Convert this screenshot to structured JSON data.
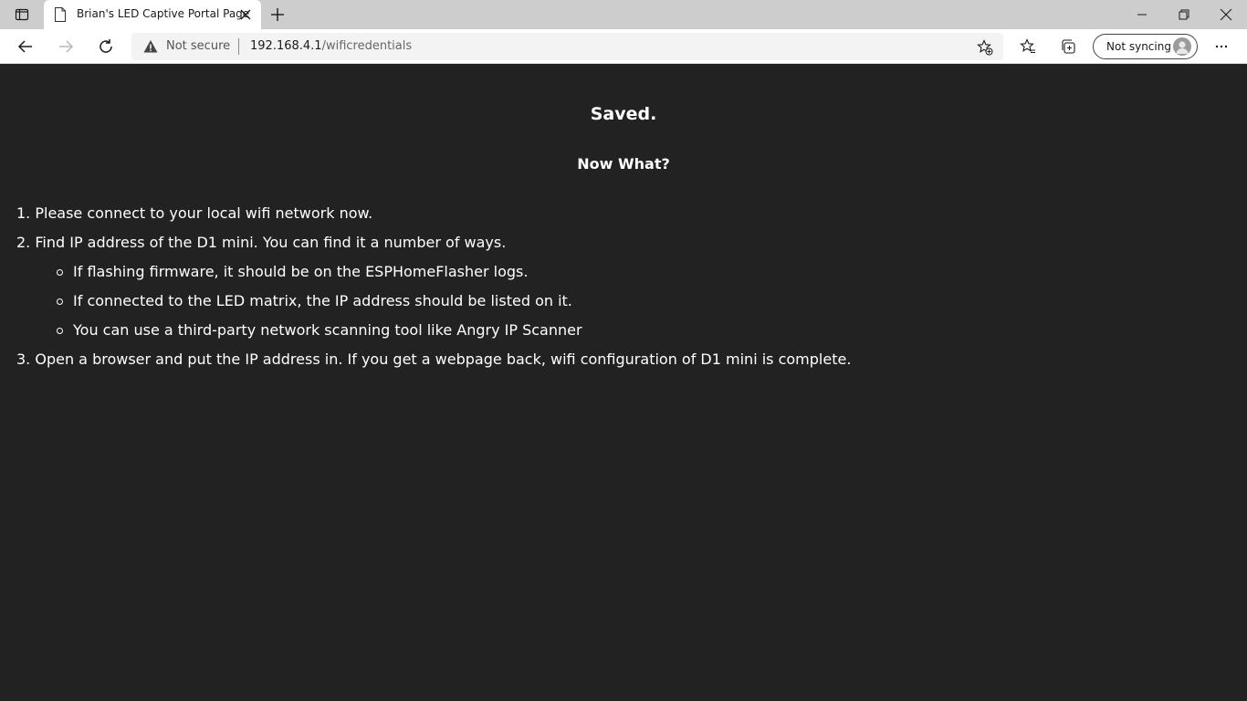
{
  "browser": {
    "tab": {
      "title": "Brian's LED Captive Portal Page"
    },
    "address_bar": {
      "security_label": "Not secure",
      "url_host": "192.168.4.1",
      "url_path": "/wificredentials"
    },
    "profile": {
      "sync_label": "Not syncing"
    },
    "icons": {
      "tab_actions": "tab-actions-icon",
      "favicon": "page-icon",
      "tab_close": "close-icon",
      "new_tab": "plus-icon",
      "minimize": "minimize-icon",
      "maximize": "restore-icon",
      "close": "close-icon",
      "back": "arrow-left-icon",
      "forward": "arrow-right-icon",
      "reload": "reload-icon",
      "warning": "warning-icon",
      "add_favorite": "star-plus-icon",
      "favorites": "favorites-icon",
      "collections": "collections-icon",
      "more": "more-icon"
    }
  },
  "page": {
    "title": "Saved.",
    "subtitle": "Now What?",
    "steps": [
      "1. Please connect to your local wifi network now.",
      "2. Find IP address of the D1 mini. You can find it a number of ways.",
      "3. Open a browser and put the IP address in. If you get a webpage back, wifi configuration of D1 mini is complete."
    ],
    "sub_steps": [
      "If flashing firmware, it should be on the ESPHomeFlasher logs.",
      "If connected to the LED matrix, the IP address should be listed on it.",
      "You can use a third-party network scanning tool like Angry IP Scanner"
    ]
  },
  "colors": {
    "page_background": "#222222",
    "page_text": "#ffffff",
    "titlebar": "#cdcdcd",
    "toolbar": "#ffffff"
  }
}
